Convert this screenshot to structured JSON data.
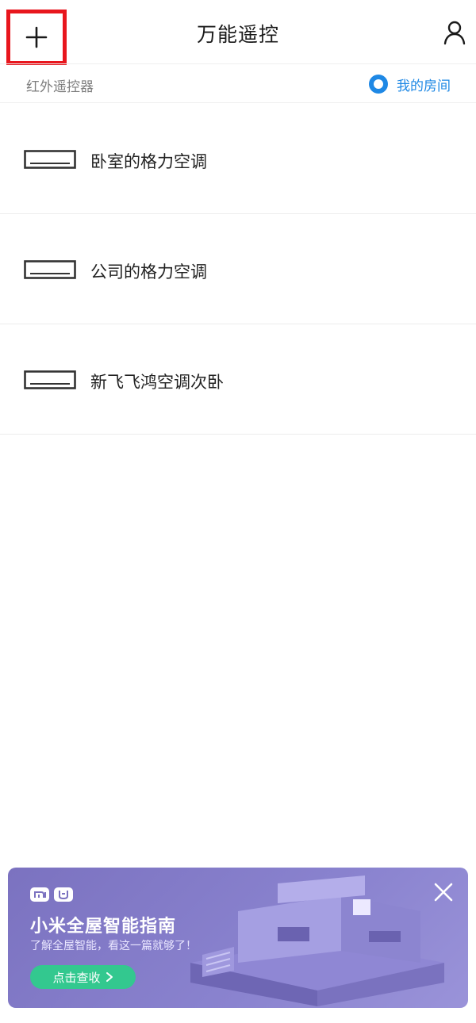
{
  "header": {
    "title": "万能遥控",
    "add_icon": "plus-icon",
    "user_icon": "user-icon"
  },
  "subheader": {
    "section_label": "红外遥控器",
    "room_link": "我的房间",
    "room_icon": "room-ring-icon",
    "accent": "#1e88e5"
  },
  "devices": [
    {
      "name": "卧室的格力空调",
      "icon": "air-conditioner-icon"
    },
    {
      "name": "公司的格力空调",
      "icon": "air-conditioner-icon"
    },
    {
      "name": "新飞飞鸿空调次卧",
      "icon": "air-conditioner-icon"
    }
  ],
  "banner": {
    "title": "小米全屋智能指南",
    "subtitle": "了解全屋智能，看这一篇就够了！",
    "cta": "点击查收",
    "cta_icon": "chevron-right-icon",
    "close_icon": "close-icon",
    "brand_icons": [
      "mi-logo-icon",
      "mijia-logo-icon"
    ],
    "bg_color": "#8a83cf",
    "cta_color": "#33c88f"
  }
}
